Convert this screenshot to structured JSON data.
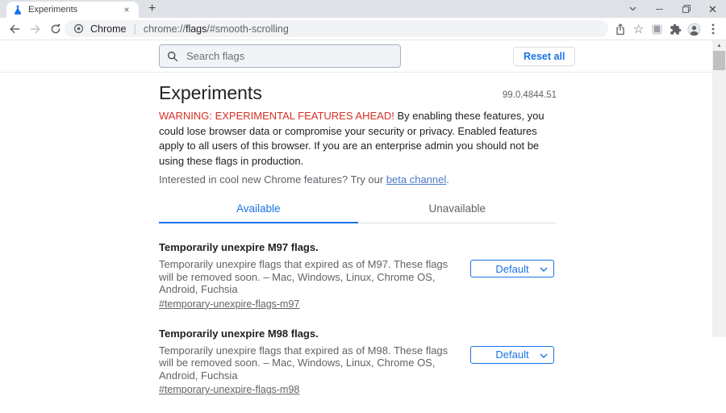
{
  "browser": {
    "tab_title": "Experiments",
    "newtab_glyph": "+",
    "close_glyph": "×",
    "address": {
      "page_label": "Chrome",
      "separator": "|",
      "url_scheme": "chrome://",
      "url_host": "flags",
      "url_path": "/#smooth-scrolling"
    }
  },
  "header": {
    "search_placeholder": "Search flags",
    "reset_button": "Reset all"
  },
  "page": {
    "title": "Experiments",
    "version": "99.0.4844.51",
    "warning": {
      "emphasis": "WARNING: EXPERIMENTAL FEATURES AHEAD!",
      "body": " By enabling these features, you could lose browser data or compromise your security or privacy. Enabled features apply to all users of this browser. If you are an enterprise admin you should not be using these flags in production."
    },
    "promo": {
      "text": "Interested in cool new Chrome features? Try our ",
      "link": "beta channel",
      "suffix": "."
    },
    "tabs": {
      "available": "Available",
      "unavailable": "Unavailable"
    },
    "flags": [
      {
        "title": "Temporarily unexpire M97 flags.",
        "description": "Temporarily unexpire flags that expired as of M97. These flags will be removed soon. – Mac, Windows, Linux, Chrome OS, Android, Fuchsia",
        "permalink": "#temporary-unexpire-flags-m97",
        "selected_value": "Default"
      },
      {
        "title": "Temporarily unexpire M98 flags.",
        "description": "Temporarily unexpire flags that expired as of M98. These flags will be removed soon. – Mac, Windows, Linux, Chrome OS, Android, Fuchsia",
        "permalink": "#temporary-unexpire-flags-m98",
        "selected_value": "Default"
      }
    ]
  },
  "scrollbar": {
    "up_arrow": "▲"
  },
  "colors": {
    "accent_blue": "#1a73e8",
    "warning_red": "#d93025",
    "text_dark": "#202124",
    "text_gray": "#5f6368",
    "tabstrip_bg": "#dee1e6",
    "omnibox_bg": "#f1f3f4"
  }
}
